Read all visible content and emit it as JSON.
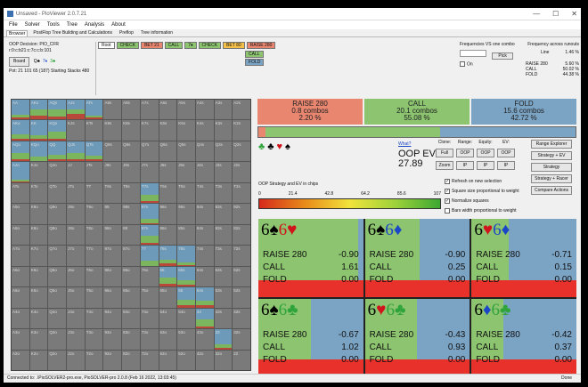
{
  "window": {
    "title": "Unsaved - PioViewer 2.0.7.21",
    "minimize": "—",
    "maximize": "☐",
    "close": "✕"
  },
  "menu": [
    "File",
    "Solver",
    "Tools",
    "Tree",
    "Analysis",
    "About"
  ],
  "tabs": [
    "Browser",
    "PostFlop Tree Building and Calculations",
    "Preflop",
    "Tree information"
  ],
  "info": {
    "decision": "OOP Decision:  PIO_CFR",
    "line": "r:0:c:b21:c:7c:c:b:101",
    "board_label": "Board",
    "board_cards": [
      {
        "rank": "Q",
        "suit": "♣",
        "color": "#000000"
      },
      {
        "rank": "7",
        "suit": "♦",
        "color": "#1a47c7"
      },
      {
        "rank": "3",
        "suit": "♣",
        "color": "#2ea43a"
      }
    ],
    "pot": "Pot: 21 101 65 (187) Starting Stacks 480"
  },
  "actions": [
    {
      "label": "Root",
      "color": "#ffffff"
    },
    {
      "label": "CHECK",
      "color": "#8cc46f"
    },
    {
      "label": "BET 21",
      "color": "#e88670"
    },
    {
      "label": "CALL",
      "color": "#8cc46f"
    },
    {
      "label": "7♦",
      "color": "#8cc46f"
    },
    {
      "label": "CHECK",
      "color": "#8cc46f"
    },
    {
      "label": "BET 80",
      "color": "#f5c04a"
    },
    {
      "label": "RAISE 280",
      "color": "#e88670"
    }
  ],
  "sub_actions": [
    {
      "label": "CALL",
      "color": "#8cc46f"
    },
    {
      "label": "FOLD",
      "color": "#7ba3c4"
    }
  ],
  "frequency": {
    "vs_label": "Frequencies VS one combo",
    "pick": "Pick",
    "on_label": "On",
    "across_label": "Frequency across runouts",
    "line_label": "Line",
    "line_value": "1.46 %",
    "rows": [
      {
        "label": "RAISE 280",
        "value": "5.60 %"
      },
      {
        "label": "CALL",
        "value": "50.02 %"
      },
      {
        "label": "FOLD",
        "value": "44.38 %"
      }
    ]
  },
  "grid_labels": [
    [
      "AA",
      "AKs",
      "AQs",
      "AJs",
      "ATs",
      "A9s",
      "A8s",
      "A7s",
      "A6s",
      "A5s",
      "A4s",
      "A3s",
      "A2s"
    ],
    [
      "AKo",
      "KK",
      "KQs",
      "KJs",
      "KTs",
      "K9s",
      "K8s",
      "K7s",
      "K6s",
      "K5s",
      "K4s",
      "K3s",
      "K2s"
    ],
    [
      "AQo",
      "KQo",
      "QQ",
      "QJs",
      "QTs",
      "Q9s",
      "Q8s",
      "Q7s",
      "Q6s",
      "Q5s",
      "Q4s",
      "Q3s",
      "Q2s"
    ],
    [
      "AJo",
      "KJo",
      "QJo",
      "JJ",
      "JTs",
      "J9s",
      "J8s",
      "J7s",
      "J6s",
      "J5s",
      "J4s",
      "J3s",
      "J2s"
    ],
    [
      "ATo",
      "KTo",
      "QTo",
      "JTo",
      "TT",
      "T9s",
      "T8s",
      "T7s",
      "T6s",
      "T5s",
      "T4s",
      "T3s",
      "T2s"
    ],
    [
      "A9o",
      "K9o",
      "Q9o",
      "J9o",
      "T9o",
      "99",
      "98s",
      "97s",
      "96s",
      "95s",
      "94s",
      "93s",
      "92s"
    ],
    [
      "A8o",
      "K8o",
      "Q8o",
      "J8o",
      "T8o",
      "98o",
      "88",
      "87s",
      "86s",
      "85s",
      "84s",
      "83s",
      "82s"
    ],
    [
      "A7o",
      "K7o",
      "Q7o",
      "J7o",
      "T7o",
      "97o",
      "87o",
      "77",
      "76s",
      "75s",
      "74s",
      "73s",
      "72s"
    ],
    [
      "A6o",
      "K6o",
      "Q6o",
      "J6o",
      "T6o",
      "96o",
      "86o",
      "76o",
      "66",
      "65s",
      "64s",
      "63s",
      "62s"
    ],
    [
      "A5o",
      "K5o",
      "Q5o",
      "J5o",
      "T5o",
      "95o",
      "85o",
      "75o",
      "65o",
      "55",
      "54s",
      "53s",
      "52s"
    ],
    [
      "A4o",
      "K4o",
      "Q4o",
      "J4o",
      "T4o",
      "94o",
      "84o",
      "74o",
      "64o",
      "54o",
      "44",
      "43s",
      "42s"
    ],
    [
      "A3o",
      "K3o",
      "Q3o",
      "J3o",
      "T3o",
      "93o",
      "83o",
      "73o",
      "63o",
      "53o",
      "43o",
      "33",
      "32s"
    ],
    [
      "A2o",
      "K2o",
      "Q2o",
      "J2o",
      "T2o",
      "92o",
      "82o",
      "72o",
      "62o",
      "52o",
      "42o",
      "32o",
      "22"
    ]
  ],
  "grid_strategy": {
    "AA": {
      "raise": 0.0,
      "call": 0.15,
      "fold": 0.1
    },
    "AKs": {
      "raise": 0.0,
      "call": 0.3,
      "fold": 0.2
    },
    "AQs": {
      "raise": 0.0,
      "call": 0.35,
      "fold": 0.15
    },
    "AJs": {
      "raise": 0.0,
      "call": 0.2,
      "fold": 0.3
    },
    "ATs": {
      "raise": 0.0,
      "call": 0.1,
      "fold": 0.1
    },
    "AKo": {
      "raise": 0.0,
      "call": 0.2,
      "fold": 0.1
    },
    "KK": {
      "raise": 0.0,
      "call": 0.15,
      "fold": 0.1
    },
    "KQs": {
      "raise": 0.0,
      "call": 0.35,
      "fold": 0.1
    },
    "AQo": {
      "raise": 0.0,
      "call": 0.3,
      "fold": 0.1
    },
    "KQo": {
      "raise": 0.0,
      "call": 0.25,
      "fold": 0.0
    },
    "QQ": {
      "raise": 0.0,
      "call": 0.25,
      "fold": 0.1
    },
    "QJs": {
      "raise": 0.0,
      "call": 0.3,
      "fold": 0.1
    },
    "QTs": {
      "raise": 0.0,
      "call": 0.2,
      "fold": 0.1
    },
    "AJo": {
      "raise": 0.0,
      "call": 0.1,
      "fold": 0.05
    },
    "T7s": {
      "raise": 0.0,
      "call": 0.3,
      "fold": 0.1
    },
    "97s": {
      "raise": 0.0,
      "call": 0.2,
      "fold": 0.05
    },
    "87s": {
      "raise": 0.0,
      "call": 0.35,
      "fold": 0.1
    },
    "77": {
      "raise": 0.0,
      "call": 0.25,
      "fold": 0.0
    },
    "76s": {
      "raise": 0.0,
      "call": 0.2,
      "fold": 0.1
    },
    "75s": {
      "raise": 0.0,
      "call": 0.1,
      "fold": 0.05
    },
    "66": {
      "raise": 0.0,
      "call": 0.3,
      "fold": 0.15
    },
    "65s": {
      "raise": 0.0,
      "call": 0.2,
      "fold": 0.1
    },
    "55": {
      "raise": 0.0,
      "call": 0.3,
      "fold": 0.1
    },
    "54s": {
      "raise": 0.0,
      "call": 0.25,
      "fold": 0.1
    },
    "44": {
      "raise": 0.0,
      "call": 0.35,
      "fold": 0.1
    },
    "33": {
      "raise": 0.0,
      "call": 0.2,
      "fold": 0.05
    }
  },
  "summary": [
    {
      "label": "RAISE 280",
      "combos": "0.8 combos",
      "pct": "2.20 %",
      "color": "#e88670",
      "fraction": 0.022
    },
    {
      "label": "CALL",
      "combos": "20.1 combos",
      "pct": "55.08 %",
      "color": "#8cc46f",
      "fraction": 0.5508
    },
    {
      "label": "FOLD",
      "combos": "15.6 combos",
      "pct": "42.72 %",
      "color": "#7ba3c4",
      "fraction": 0.4272
    }
  ],
  "suits": [
    {
      "g": "♣",
      "c": "#2ea43a"
    },
    {
      "g": "♣",
      "c": "#000000"
    },
    {
      "g": "♥",
      "c": "#d0141c"
    },
    {
      "g": "♠",
      "c": "#000000"
    }
  ],
  "ev": {
    "what": "What?",
    "label": "OOP EV:",
    "value": "27.89"
  },
  "controls": {
    "headers": [
      "Clone:",
      "Range:",
      "Equity:",
      "EV:"
    ],
    "buttons": [
      "Full",
      "OOP",
      "OOP",
      "OOP",
      "Zoom",
      "IP",
      "IP",
      "IP"
    ]
  },
  "right_buttons": [
    "Range Explorer",
    "Strategy + EV",
    "Strategy",
    "Strategy + Racer",
    "Compare Actions"
  ],
  "gradient": {
    "label": "OOP Strategy and EV in chips",
    "ticks": [
      "0",
      "21.4",
      "42.8",
      "64.2",
      "85.6",
      "107"
    ]
  },
  "options": [
    {
      "label": "Refresh on new selection",
      "checked": true
    },
    {
      "label": "Square size proportional to weight",
      "checked": true
    },
    {
      "label": "Normalize squares",
      "checked": true
    },
    {
      "label": "Bars width proportional to weight",
      "checked": false
    }
  ],
  "combos": [
    {
      "r1": "6",
      "s1": "♠",
      "c1": "#000000",
      "r2": "6",
      "s2": "♥",
      "c2": "#d0141c",
      "raise": "-0.90",
      "call": "1.61",
      "fold": "0.00",
      "call_frac": 0.95
    },
    {
      "r1": "6",
      "s1": "♠",
      "c1": "#000000",
      "r2": "6",
      "s2": "♦",
      "c2": "#1a47c7",
      "raise": "-0.90",
      "call": "0.25",
      "fold": "0.00",
      "call_frac": 0.52
    },
    {
      "r1": "6",
      "s1": "♥",
      "c1": "#d0141c",
      "r2": "6",
      "s2": "♦",
      "c2": "#1a47c7",
      "raise": "-0.71",
      "call": "0.15",
      "fold": "0.00",
      "call_frac": 0.35
    },
    {
      "r1": "6",
      "s1": "♠",
      "c1": "#000000",
      "r2": "6",
      "s2": "♣",
      "c2": "#2ea43a",
      "raise": "-0.67",
      "call": "1.02",
      "fold": "0.00",
      "call_frac": 0.5
    },
    {
      "r1": "6",
      "s1": "♥",
      "c1": "#d0141c",
      "r2": "6",
      "s2": "♣",
      "c2": "#2ea43a",
      "raise": "-0.43",
      "call": "0.93",
      "fold": "0.00",
      "call_frac": 0.5
    },
    {
      "r1": "6",
      "s1": "♦",
      "c1": "#1a47c7",
      "r2": "6",
      "s2": "♣",
      "c2": "#2ea43a",
      "raise": "-0.42",
      "call": "0.37",
      "fold": "0.00",
      "call_frac": 0.3
    }
  ],
  "combo_labels": {
    "raise": "RAISE 280",
    "call": "CALL",
    "fold": "FOLD"
  },
  "status": {
    "left": "Connected to: .\\PioSOLVER2-pro.exe, PioSOLVER-pro 2.0.8 (Feb 16 2022, 13:03:45)",
    "right": "Done"
  }
}
